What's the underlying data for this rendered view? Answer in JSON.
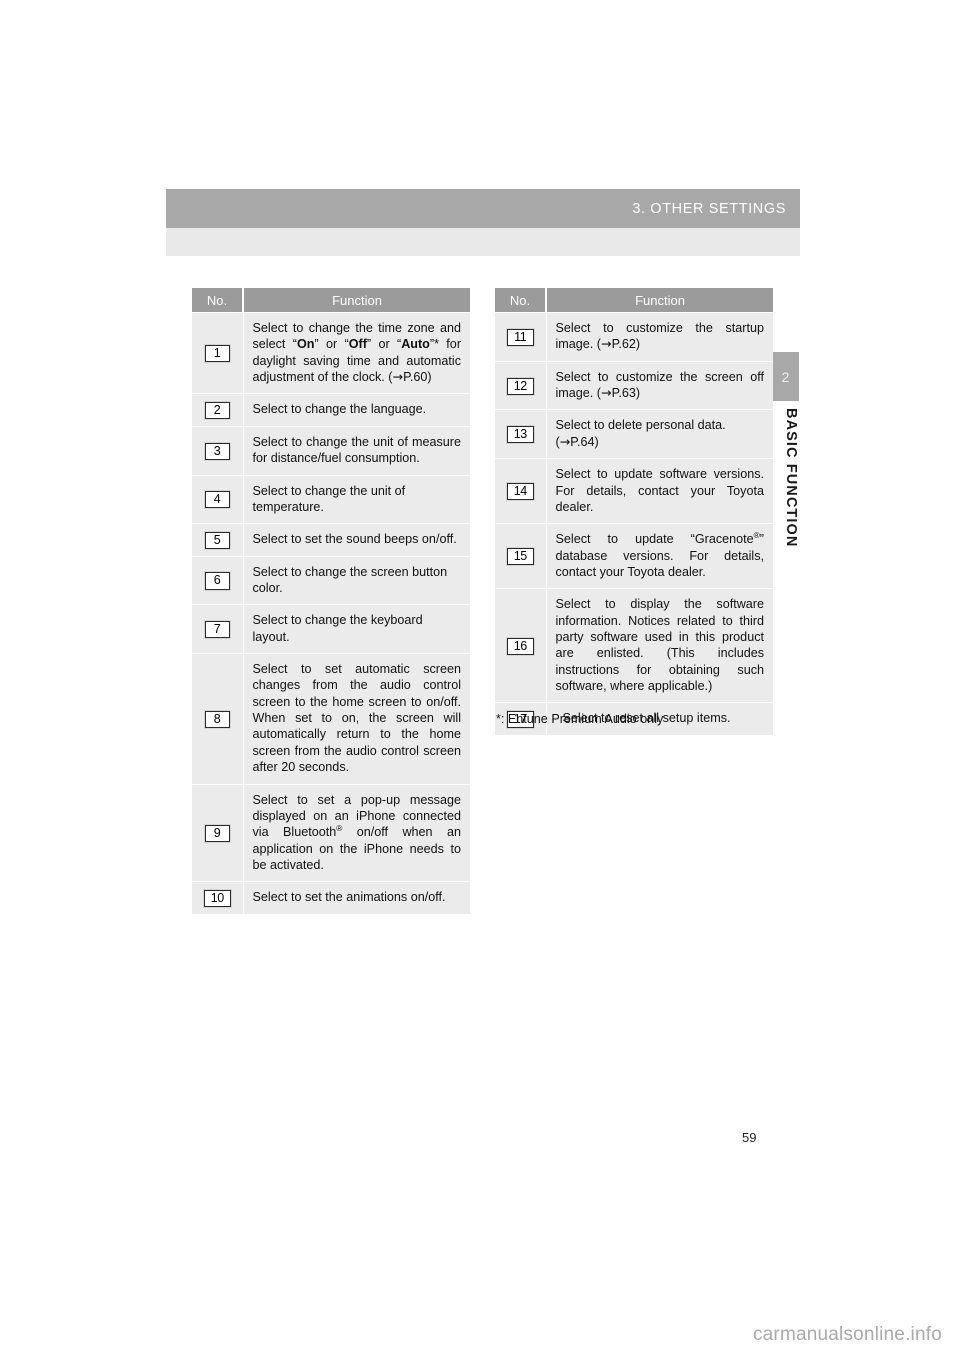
{
  "header": {
    "title": "3. OTHER SETTINGS"
  },
  "sidebar": {
    "chapter_number": "2",
    "chapter_label": "BASIC FUNCTION"
  },
  "tables": {
    "columns": {
      "no": "No.",
      "function": "Function"
    },
    "left_rows": [
      {
        "no": "1",
        "text": "Select to change the time zone and select “On” or “Off” or “Auto”* for daylight saving time and automatic adjustment of the clock. (→P.60)"
      },
      {
        "no": "2",
        "text": "Select to change the language."
      },
      {
        "no": "3",
        "text": "Select to change the unit of measure for distance/fuel consumption."
      },
      {
        "no": "4",
        "text": "Select to change the unit of temperature."
      },
      {
        "no": "5",
        "text": "Select to set the sound beeps on/off."
      },
      {
        "no": "6",
        "text": "Select to change the screen button color."
      },
      {
        "no": "7",
        "text": "Select to change the keyboard layout."
      },
      {
        "no": "8",
        "text": "Select to set automatic screen changes from the audio control screen to the home screen to on/off. When set to on, the screen will automatically return to the home screen from the audio control screen after 20 seconds."
      },
      {
        "no": "9",
        "text": "Select to set a pop-up message displayed on an iPhone connected via Bluetooth® on/off when an application on the iPhone needs to be activated."
      },
      {
        "no": "10",
        "text": "Select to set the animations on/off."
      }
    ],
    "right_rows": [
      {
        "no": "11",
        "text": "Select to customize the startup image. (→P.62)"
      },
      {
        "no": "12",
        "text": "Select to customize the screen off image. (→P.63)"
      },
      {
        "no": "13",
        "text": "Select to delete personal data. (→P.64)"
      },
      {
        "no": "14",
        "text": "Select to update software versions. For details, contact your Toyota dealer."
      },
      {
        "no": "15",
        "text": "Select to update “Gracenote®” database versions. For details, contact your Toyota dealer."
      },
      {
        "no": "16",
        "text": "Select to display the software information. Notices related to third party software used in this product are enlisted. (This includes instructions for obtaining such software, where applicable.)"
      },
      {
        "no": "17",
        "text": "Select to reset all setup items."
      }
    ]
  },
  "footnote": "*: Entune Premium Audio only",
  "page_number": "59",
  "watermark": "carmanualsonline.info",
  "colors": {
    "header_bar": "#a8a8a8",
    "sub_bar": "#e9e9e9",
    "table_header": "#9b9b9b",
    "table_cell": "#ebebeb",
    "text": "#111111",
    "watermark": "#aaaaaa"
  }
}
